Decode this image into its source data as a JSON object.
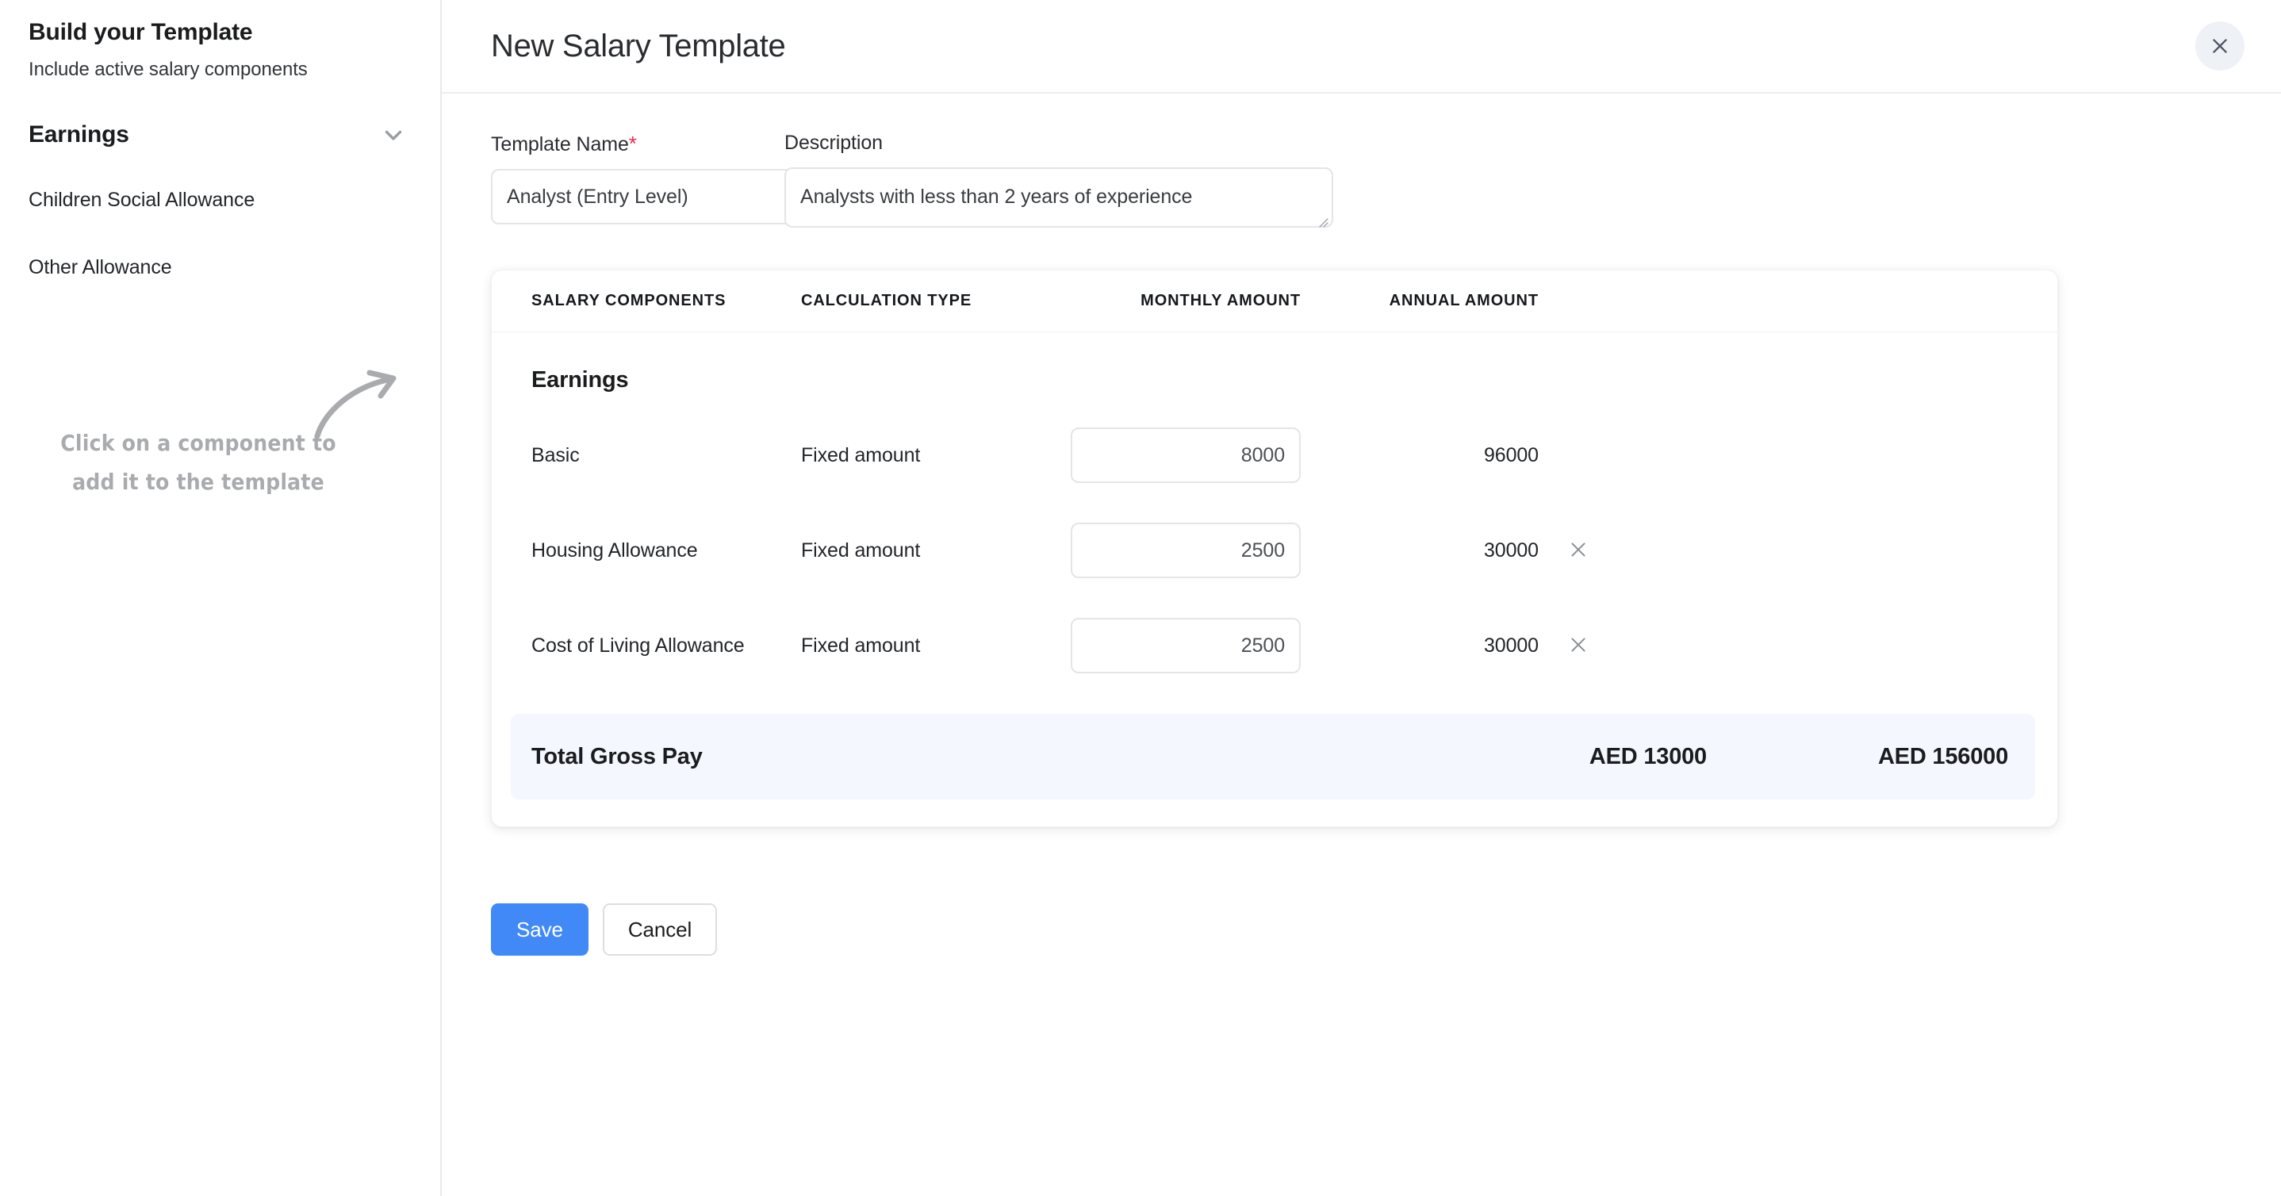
{
  "sidebar": {
    "title": "Build your Template",
    "subtitle": "Include active salary components",
    "group": {
      "label": "Earnings",
      "icon": "chevron-down-icon"
    },
    "items": [
      {
        "label": "Children Social Allowance"
      },
      {
        "label": "Other Allowance"
      }
    ],
    "hint": {
      "line1": "Click on a component to",
      "line2": "add it to the template",
      "icon": "curved-arrow-icon"
    }
  },
  "header": {
    "title": "New Salary Template",
    "close_icon": "close-icon"
  },
  "form": {
    "template_name": {
      "label": "Template Name",
      "required_marker": "*",
      "value": "Analyst (Entry Level)",
      "placeholder": "Template Name"
    },
    "description": {
      "label": "Description",
      "value": "Analysts with less than 2 years of experience",
      "placeholder": "Description"
    }
  },
  "table": {
    "columns": {
      "component": "SALARY COMPONENTS",
      "calculation": "CALCULATION TYPE",
      "monthly": "MONTHLY AMOUNT",
      "annual": "ANNUAL AMOUNT"
    },
    "section_title": "Earnings",
    "rows": [
      {
        "component": "Basic",
        "calculation": "Fixed amount",
        "monthly": "8000",
        "annual": "96000",
        "deletable": false
      },
      {
        "component": "Housing Allowance",
        "calculation": "Fixed amount",
        "monthly": "2500",
        "annual": "30000",
        "deletable": true
      },
      {
        "component": "Cost of Living Allowance",
        "calculation": "Fixed amount",
        "monthly": "2500",
        "annual": "30000",
        "deletable": true
      }
    ],
    "total": {
      "label": "Total Gross Pay",
      "monthly": "AED 13000",
      "annual": "AED 156000"
    }
  },
  "actions": {
    "save": "Save",
    "cancel": "Cancel"
  },
  "colors": {
    "primary": "#4189f7",
    "required": "#f0294a",
    "total_row_bg": "#f4f7fe",
    "close_bg": "#eef2f7",
    "hint_text": "#a9abae"
  }
}
